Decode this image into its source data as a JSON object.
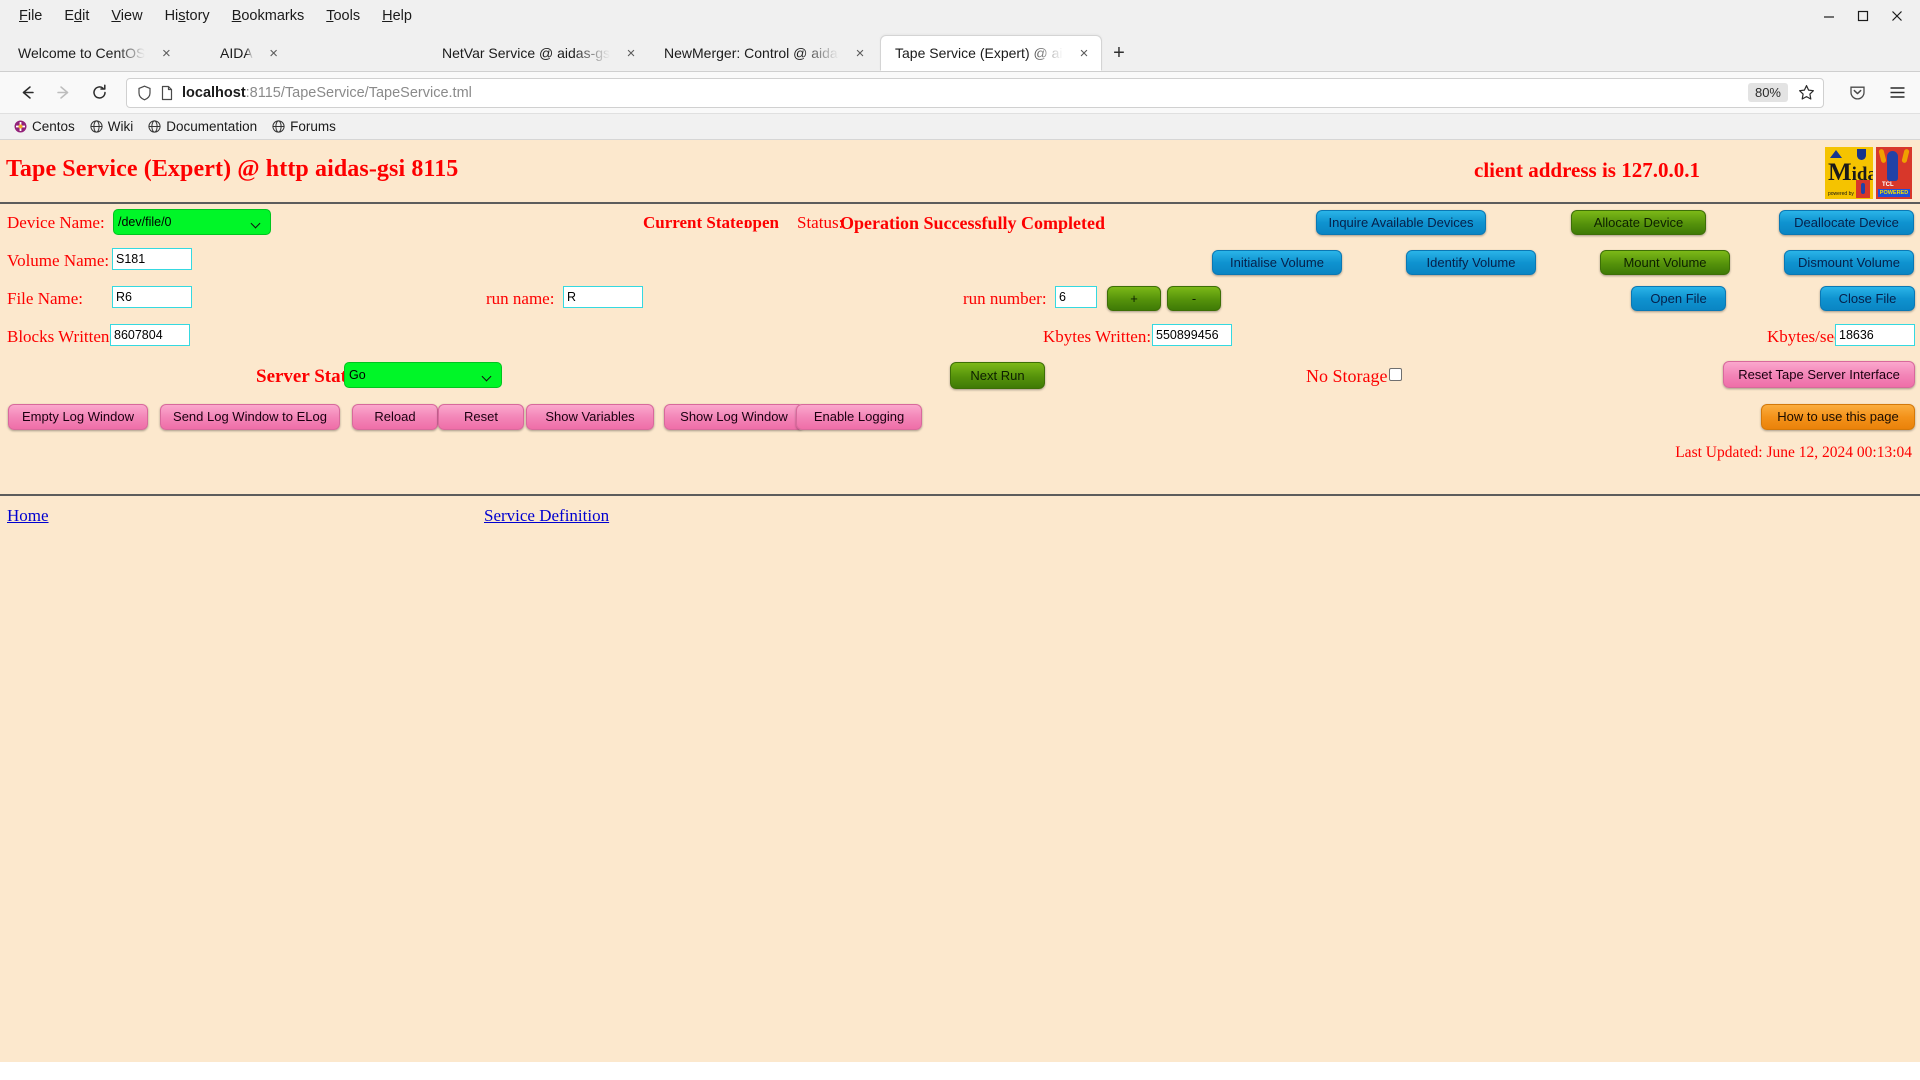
{
  "browser": {
    "menus": [
      "File",
      "Edit",
      "View",
      "History",
      "Bookmarks",
      "Tools",
      "Help"
    ],
    "window_controls": {
      "minimize": "minimize-icon",
      "maximize": "maximize-icon",
      "close": "close-icon"
    },
    "tabs": [
      {
        "label": "Welcome to CentOS",
        "active": false
      },
      {
        "label": "AIDA",
        "active": false
      },
      {
        "label": "NetVar Service @ aidas-gsi",
        "active": false
      },
      {
        "label": "NewMerger: Control @ aidas-gsi",
        "active": false
      },
      {
        "label": "Tape Service (Expert) @ aidas-gsi",
        "active": true
      }
    ],
    "new_tab_label": "+",
    "nav": {
      "back": "back-arrow-icon",
      "forward": "forward-arrow-icon",
      "reload": "reload-icon"
    },
    "url": {
      "host": "localhost",
      "path": ":8115/TapeService/TapeService.tml",
      "full": "localhost:8115/TapeService/TapeService.tml"
    },
    "zoom_level": "80%",
    "bookmarks": [
      "Centos",
      "Wiki",
      "Documentation",
      "Forums"
    ]
  },
  "page": {
    "title": "Tape Service (Expert) @ http aidas-gsi 8115",
    "client_address": "client address is 127.0.0.1",
    "labels": {
      "device_name": "Device Name:",
      "volume_name": "Volume Name:",
      "file_name": "File Name:",
      "run_name": "run name:",
      "run_number": "run number:",
      "blocks_written": "Blocks Written:",
      "kbytes_written": "Kbytes Written:",
      "kbytes_per_sec": "Kbytes/sec:",
      "server_state": "Server State",
      "no_storage": "No Storage",
      "current_state": "Current State:",
      "status": "Status:"
    },
    "values": {
      "device_name": "/dev/file/0",
      "volume_name": "S181",
      "file_name": "R6",
      "run_name": "R",
      "run_number": "6",
      "blocks_written": "8607804",
      "kbytes_written": "550899456",
      "kbytes_per_sec": "18636",
      "server_state": "Go",
      "current_state": "open",
      "status": "Operation Successfully Completed",
      "no_storage_checked": false
    },
    "buttons": {
      "inquire_available_devices": "Inquire Available Devices",
      "allocate_device": "Allocate Device",
      "deallocate_device": "Deallocate Device",
      "initialise_volume": "Initialise Volume",
      "identify_volume": "Identify Volume",
      "mount_volume": "Mount Volume",
      "dismount_volume": "Dismount Volume",
      "open_file": "Open File",
      "close_file": "Close File",
      "run_plus": "+",
      "run_minus": "-",
      "next_run": "Next Run",
      "reset_tape_server_interface": "Reset Tape Server Interface",
      "empty_log_window": "Empty Log Window",
      "send_log_window_to_elog": "Send Log Window to ELog",
      "reload": "Reload",
      "reset": "Reset",
      "show_variables": "Show Variables",
      "show_log_window": "Show Log Window",
      "enable_logging": "Enable Logging",
      "how_to_use_this_page": "How to use this page"
    },
    "last_updated": "Last Updated: June 12, 2024 00:13:04",
    "footer": {
      "home": "Home",
      "service_definition": "Service Definition"
    },
    "colors": {
      "page_background": "#fce8cd",
      "label_red": "#fd0000",
      "select_green": "#00f628",
      "input_border_cyan": "#35d9e0",
      "button_blue": "#0f93d0",
      "button_green": "#55920b",
      "button_pink": "#f386b8",
      "button_orange": "#f3921a",
      "link_blue": "#0000d0"
    }
  }
}
